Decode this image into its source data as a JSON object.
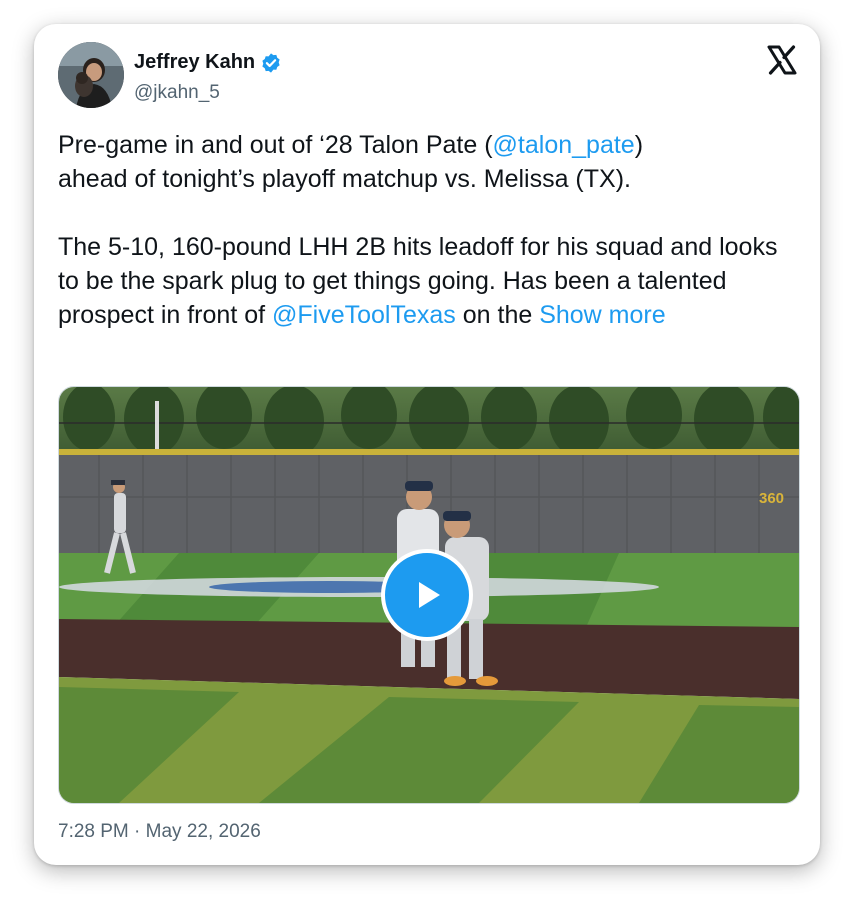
{
  "author": {
    "name": "Jeffrey Kahn",
    "handle": "@jkahn_5"
  },
  "tweet": {
    "line1_pre": "Pre-game in and out of ‘28 Talon Pate (",
    "mention1": "@talon_pate",
    "line1_post": ")",
    "line2": "ahead of tonight’s playoff matchup vs. Melissa (TX).",
    "para2_pre": "The 5-10, 160-pound LHH 2B hits leadoff for his squad and looks to be the spark plug to get things going. Has been a talented prospect in front of ",
    "mention2": "@FiveToolTexas",
    "para2_post": " on the ",
    "show_more": "Show more"
  },
  "media": {
    "wall_sign": "360"
  },
  "timestamp": "7:28 PM · May 22, 2026",
  "colors": {
    "link": "#1d9bf0",
    "verified": "#1d9bf0",
    "text": "#0f1419",
    "secondary": "#536471"
  },
  "icons": [
    "verified-badge-icon",
    "x-logo-icon",
    "play-icon"
  ]
}
